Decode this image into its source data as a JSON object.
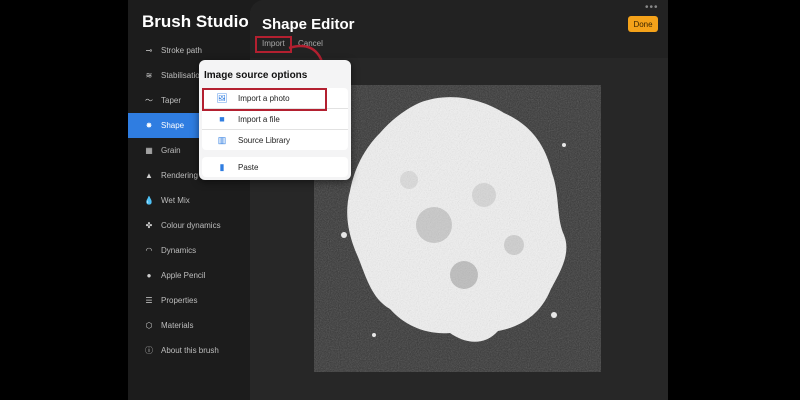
{
  "app": {
    "title": "Brush Studio"
  },
  "sidebar": {
    "items": [
      {
        "label": "Stroke path",
        "icon": "stroke-path-icon",
        "active": false
      },
      {
        "label": "Stabilisation",
        "icon": "stabilisation-icon",
        "active": false
      },
      {
        "label": "Taper",
        "icon": "taper-icon",
        "active": false
      },
      {
        "label": "Shape",
        "icon": "shape-icon",
        "active": true
      },
      {
        "label": "Grain",
        "icon": "grain-icon",
        "active": false
      },
      {
        "label": "Rendering",
        "icon": "rendering-icon",
        "active": false
      },
      {
        "label": "Wet Mix",
        "icon": "wet-mix-icon",
        "active": false
      },
      {
        "label": "Colour dynamics",
        "icon": "colour-dynamics-icon",
        "active": false
      },
      {
        "label": "Dynamics",
        "icon": "dynamics-icon",
        "active": false
      },
      {
        "label": "Apple Pencil",
        "icon": "apple-pencil-icon",
        "active": false
      },
      {
        "label": "Properties",
        "icon": "properties-icon",
        "active": false
      },
      {
        "label": "Materials",
        "icon": "materials-icon",
        "active": false
      },
      {
        "label": "About this brush",
        "icon": "about-icon",
        "active": false
      }
    ]
  },
  "editor": {
    "title": "Shape Editor",
    "import_label": "Import",
    "cancel_label": "Cancel",
    "done_label": "Done"
  },
  "popover": {
    "title": "Image source options",
    "items": [
      {
        "label": "Import a photo",
        "icon": "photo-icon"
      },
      {
        "label": "Import a file",
        "icon": "folder-icon"
      },
      {
        "label": "Source Library",
        "icon": "library-icon"
      },
      {
        "label": "Paste",
        "icon": "paste-icon"
      }
    ]
  },
  "colors": {
    "accent": "#2f7de1",
    "done": "#f4a21a",
    "highlight": "#b32030",
    "background": "#1c1c1c"
  }
}
